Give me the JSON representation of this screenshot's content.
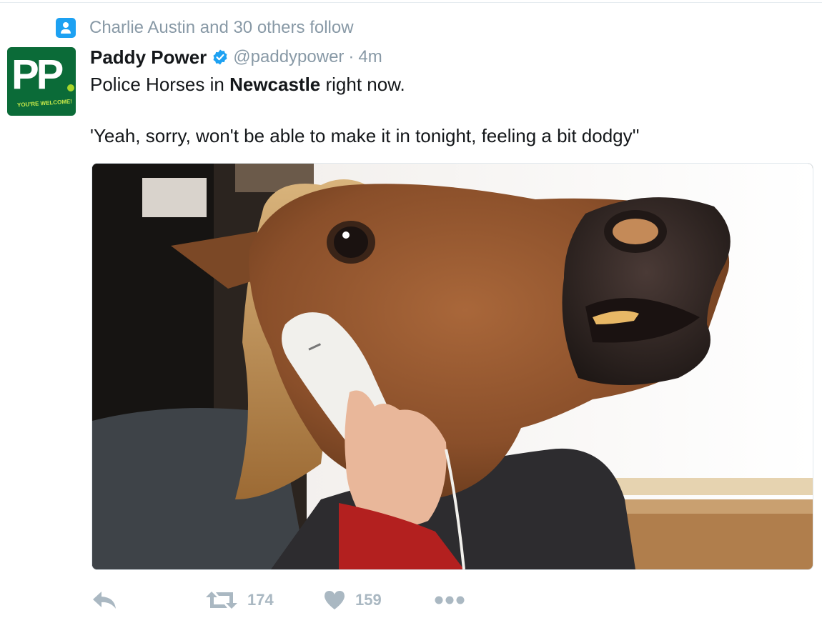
{
  "context": {
    "icon": "person-icon",
    "text": "Charlie Austin and 30 others follow"
  },
  "tweet": {
    "avatar": {
      "logo_text": "PP",
      "tagline": "YOU'RE WELCOME!",
      "bg_color": "#0b6b38",
      "accent_color": "#a8d62a"
    },
    "display_name": "Paddy Power",
    "verified": true,
    "handle": "@paddypower",
    "separator": "·",
    "time": "4m",
    "text_line1_before": "Police Horses in ",
    "text_line1_bold": "Newcastle",
    "text_line1_after": " right now.",
    "text_line2": "'Yeah, sorry, won't be able to make it in tonight, feeling a bit dodgy''",
    "media": {
      "icon": "photo-horse-mask-on-phone"
    }
  },
  "actions": {
    "reply_icon": "reply-icon",
    "retweet_icon": "retweet-icon",
    "retweet_count": "174",
    "like_icon": "heart-icon",
    "like_count": "159",
    "more_icon": "more-dots-icon"
  },
  "colors": {
    "accent": "#1da1f2",
    "muted": "#8899a6",
    "action": "#aab8c2",
    "text": "#14171a"
  }
}
